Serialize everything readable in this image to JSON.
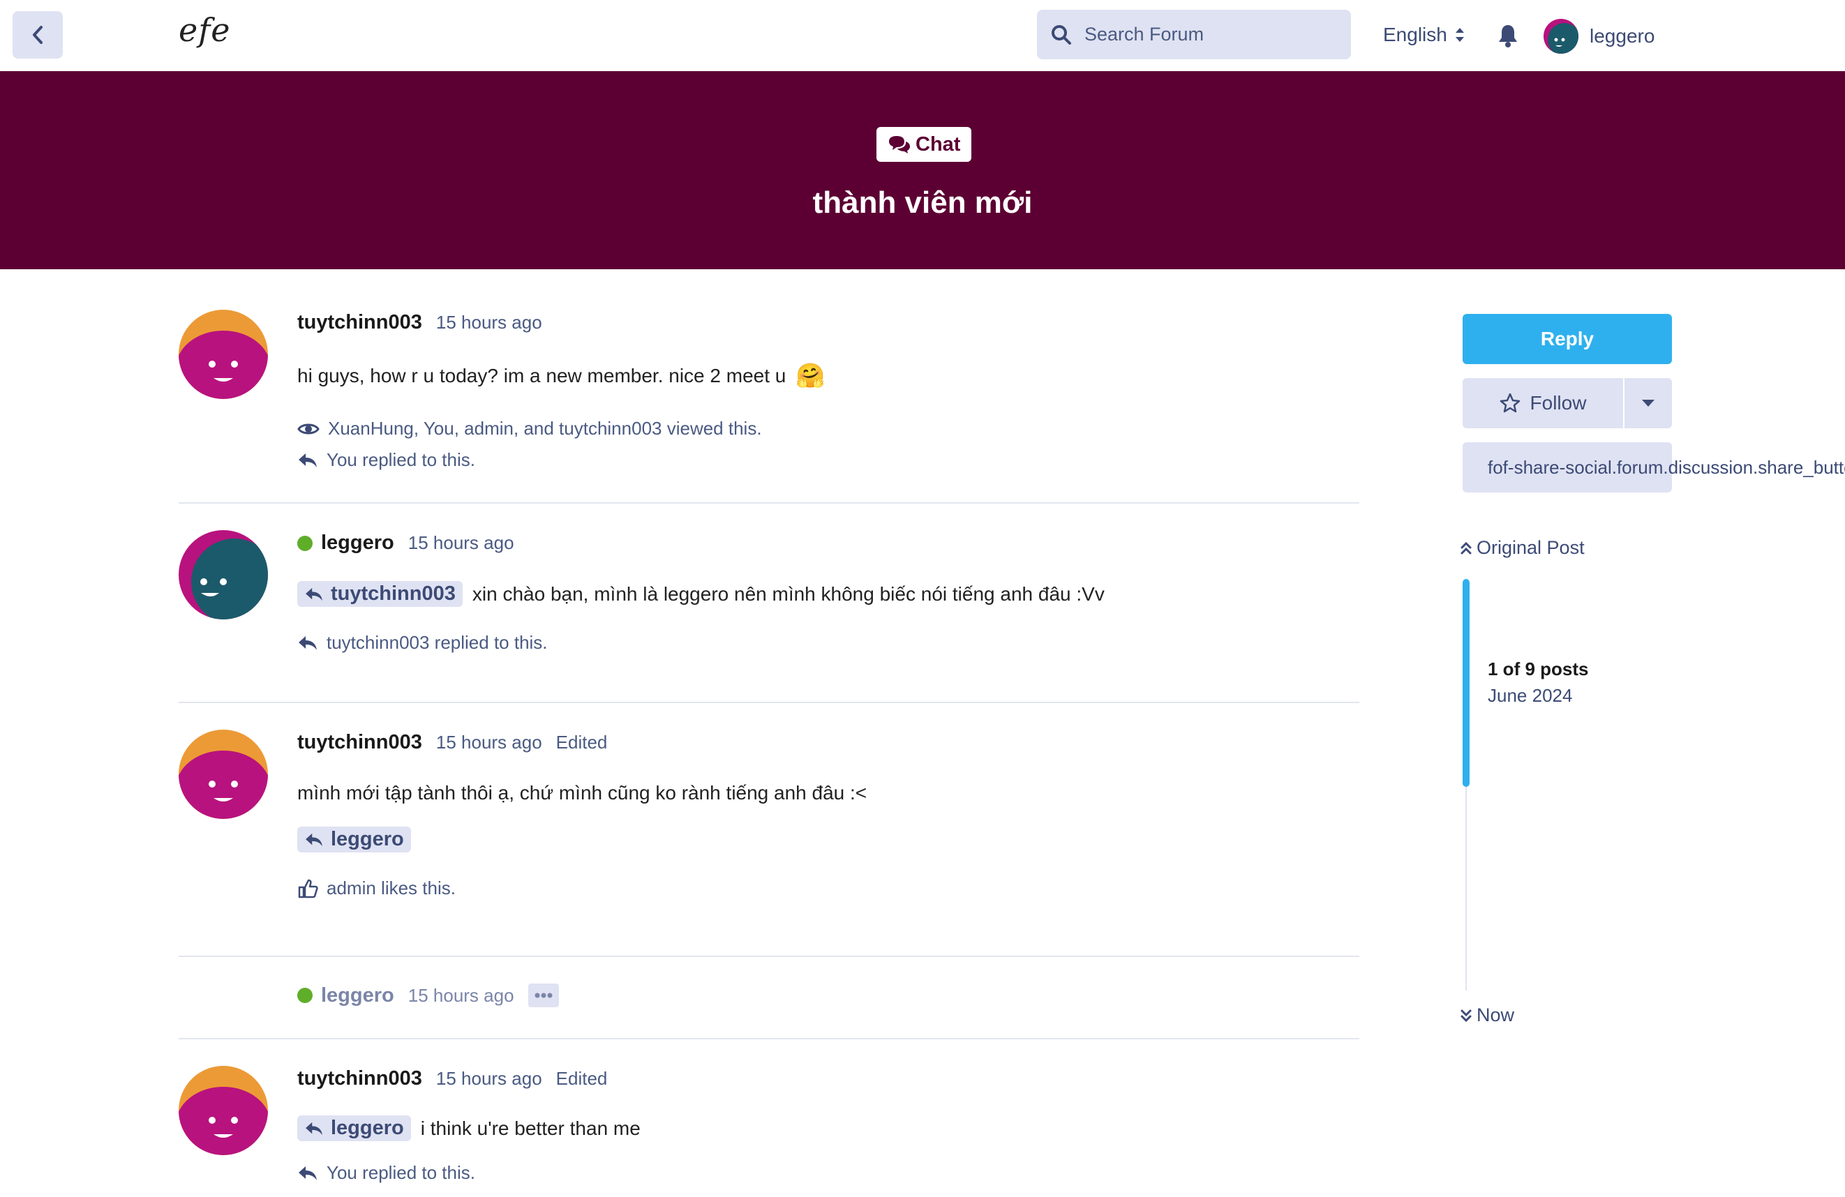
{
  "header": {
    "logo": "efe",
    "search_placeholder": "Search Forum",
    "language": "English",
    "username": "leggero"
  },
  "discussion": {
    "tag": "Chat",
    "title": "thành viên mới"
  },
  "posts": [
    {
      "author": "tuytchinn003",
      "time": "15 hours ago",
      "edited": "",
      "content": "hi guys, how r u today? im a new member. nice 2 meet u",
      "emoji": "🤗",
      "viewed": "XuanHung, You, admin, and tuytchinn003 viewed this.",
      "replied": "You replied to this."
    },
    {
      "author": "leggero",
      "time": "15 hours ago",
      "mention": "tuytchinn003",
      "content": "xin chào bạn, mình là leggero nên mình không biếc nói tiếng anh đâu :Vv",
      "replied": "tuytchinn003 replied to this."
    },
    {
      "author": "tuytchinn003",
      "time": "15 hours ago",
      "edited": "Edited",
      "content": "mình mới tập tành thôi ạ, chứ mình cũng ko rành tiếng anh đâu :<",
      "mention": "leggero",
      "likes": "admin likes this."
    },
    {
      "author": "leggero",
      "time": "15 hours ago"
    },
    {
      "author": "tuytchinn003",
      "time": "15 hours ago",
      "edited": "Edited",
      "mention": "leggero",
      "content": "i think u're better than me",
      "replied": "You replied to this."
    }
  ],
  "sidebar": {
    "reply_label": "Reply",
    "follow_label": "Follow",
    "share_label": "fof-share-social.forum.discussion.share_button",
    "original_post": "Original Post",
    "scrubber_count": "1 of 9 posts",
    "scrubber_date": "June 2024",
    "now_label": "Now"
  },
  "colors": {
    "hero": "#5c0033",
    "accent": "#2fb0ee",
    "chip": "#dfe2f2",
    "muted_text": "#4a5a82",
    "online": "#5fae2a"
  },
  "icons": [
    "chevron-left-icon",
    "search-icon",
    "sort-icon",
    "bell-icon",
    "comments-icon",
    "eye-icon",
    "reply-icon",
    "thumbs-up-icon",
    "star-icon",
    "caret-down-icon",
    "share-icon",
    "angle-double-up-icon",
    "angle-double-down-icon",
    "ellipsis-icon"
  ]
}
